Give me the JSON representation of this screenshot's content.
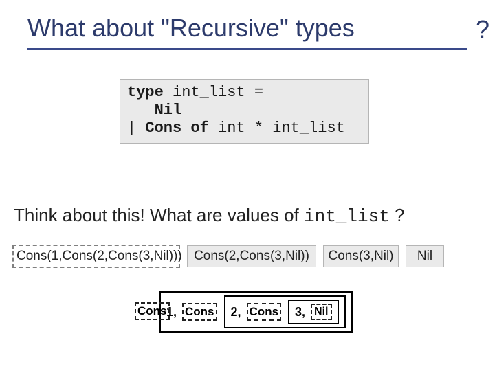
{
  "title": "What about \"Recursive\" types",
  "title_qmark": "?",
  "code": {
    "kw_type": "type",
    "typename": " int_list =",
    "ctor_nil": "Nil",
    "pipe": "| ",
    "ctor_cons": "Cons of",
    "cons_rest": " int * int_list"
  },
  "subtitle_a": "Think about this! What are values of ",
  "subtitle_mono": "int_list",
  "subtitle_b": " ?",
  "values": {
    "v1": "Cons(1,Cons(2,Cons(3,Nil)))",
    "v2": "Cons(2,Cons(3,Nil))",
    "v3": "Cons(3,Nil)",
    "v4": "Nil"
  },
  "nested": {
    "cons": "Cons",
    "nil": "Nil",
    "lead1": "1,",
    "lead2": "2,",
    "lead3": "3,"
  }
}
